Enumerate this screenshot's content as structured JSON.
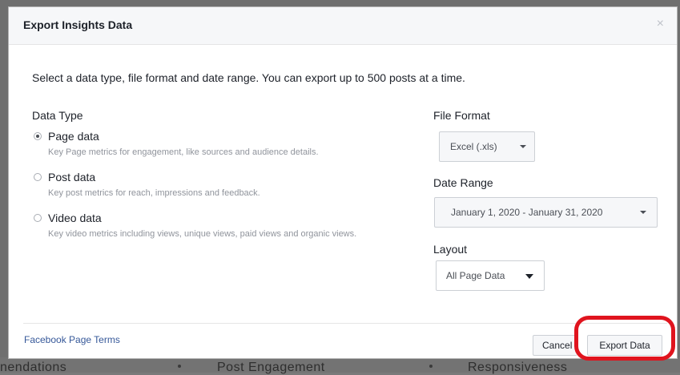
{
  "background": {
    "items": [
      "nendations",
      "Post Engagement",
      "Responsiveness"
    ]
  },
  "dialog": {
    "title": "Export Insights Data",
    "close_label": "×",
    "intro": "Select a data type, file format and date range. You can export up to 500 posts at a time."
  },
  "data_type": {
    "heading": "Data Type",
    "options": [
      {
        "label": "Page data",
        "description": "Key Page metrics for engagement, like sources and audience details.",
        "selected": true
      },
      {
        "label": "Post data",
        "description": "Key post metrics for reach, impressions and feedback.",
        "selected": false
      },
      {
        "label": "Video data",
        "description": "Key video metrics including views, unique views, paid views and organic views.",
        "selected": false
      }
    ]
  },
  "file_format": {
    "heading": "File Format",
    "value": "Excel (.xls)"
  },
  "date_range": {
    "heading": "Date Range",
    "value": "January 1, 2020 - January 31, 2020"
  },
  "layout": {
    "heading": "Layout",
    "value": "All Page Data"
  },
  "footer": {
    "terms_link": "Facebook Page Terms",
    "cancel_label": "Cancel",
    "export_label": "Export Data"
  },
  "colors": {
    "highlight": "#e0141e",
    "link": "#365899"
  }
}
